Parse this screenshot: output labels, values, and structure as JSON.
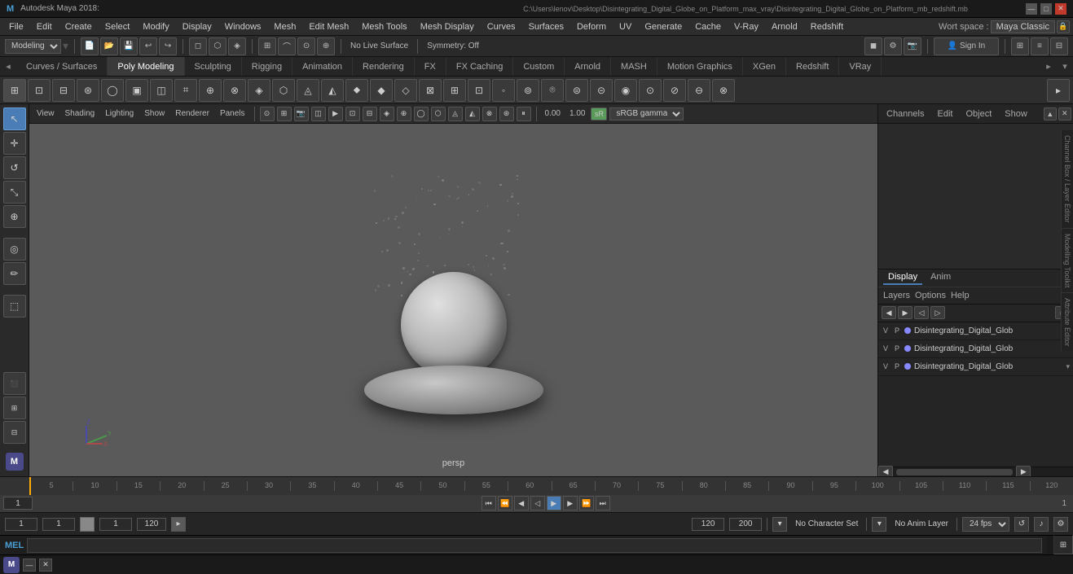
{
  "titlebar": {
    "app": "Autodesk Maya 2018:",
    "filename": "C:\\Users\\lenov\\Desktop\\Disintegrating_Digital_Globe_on_Platform_max_vray\\Disintegrating_Digital_Globe_on_Platform_mb_redshift.mb",
    "close": "✕",
    "minimize": "—",
    "maximize": "□"
  },
  "menubar": {
    "items": [
      "File",
      "Edit",
      "Create",
      "Select",
      "Modify",
      "Display",
      "Windows",
      "Mesh",
      "Edit Mesh",
      "Mesh Tools",
      "Mesh Display",
      "Curves",
      "Surfaces",
      "Deform",
      "UV",
      "Generate",
      "Cache",
      "V-Ray",
      "Arnold",
      "Redshift"
    ]
  },
  "workspace": {
    "label": "Wort space :",
    "value": "Maya Classic"
  },
  "toolbar": {
    "modeling_dropdown": "Modeling",
    "symmetry_off": "Symmetry: Off",
    "no_live_surface": "No Live Surface"
  },
  "tabs": {
    "items": [
      "Curves / Surfaces",
      "Poly Modeling",
      "Sculpting",
      "Rigging",
      "Animation",
      "Rendering",
      "FX",
      "FX Caching",
      "Custom",
      "Arnold",
      "MASH",
      "Motion Graphics",
      "XGen",
      "Redshift",
      "VRay"
    ]
  },
  "viewport": {
    "menu": [
      "View",
      "Shading",
      "Lighting",
      "Show",
      "Renderer",
      "Panels"
    ],
    "camera": "persp",
    "gamma": "sRGB gamma",
    "values": {
      "zero": "0.00",
      "one": "1.00"
    }
  },
  "right_panel": {
    "tabs": [
      "Channels",
      "Edit",
      "Object",
      "Show"
    ],
    "display_tabs": [
      "Display",
      "Anim"
    ],
    "layer_ops": [
      "Layers",
      "Options",
      "Help"
    ],
    "layers": [
      {
        "v": "V",
        "p": "P",
        "color": "#8888ff",
        "name": "Disintegrating_Digital_Glob"
      },
      {
        "v": "V",
        "p": "P",
        "color": "#8888ff",
        "name": "Disintegrating_Digital_Glob"
      },
      {
        "v": "V",
        "p": "P",
        "color": "#8888ff",
        "name": "Disintegrating_Digital_Glob"
      }
    ]
  },
  "timeline": {
    "start": "1",
    "current": "1",
    "range_start": "1",
    "range_start2": "120",
    "range_end": "120",
    "range_end2": "200",
    "fps": "24 fps"
  },
  "bottom_bar": {
    "no_character_set": "No Character Set",
    "no_anim_layer": "No Anim Layer",
    "frame_value": "1",
    "frame_value2": "1",
    "frame_range": "120"
  },
  "commandline": {
    "label": "MEL",
    "placeholder": ""
  },
  "side_labels": {
    "channel_box": "Channel Box / Layer Editor",
    "modeling_toolkit": "Modelling Toolkit",
    "attribute_editor": "Attribute Editor"
  }
}
